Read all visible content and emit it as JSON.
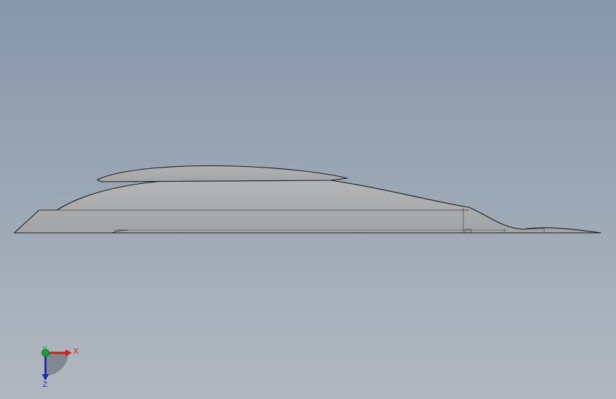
{
  "viewport": {
    "background_top": "#8797a9",
    "background_bottom": "#b1b8c0"
  },
  "model": {
    "fill_color": "#a9aaab",
    "edge_color": "#1b1b1b"
  },
  "triad": {
    "x_label": "X",
    "y_label": "Y",
    "z_label": "Z",
    "x_color": "#c0241c",
    "y_color": "#19a033",
    "z_color": "#1c2fb4"
  }
}
